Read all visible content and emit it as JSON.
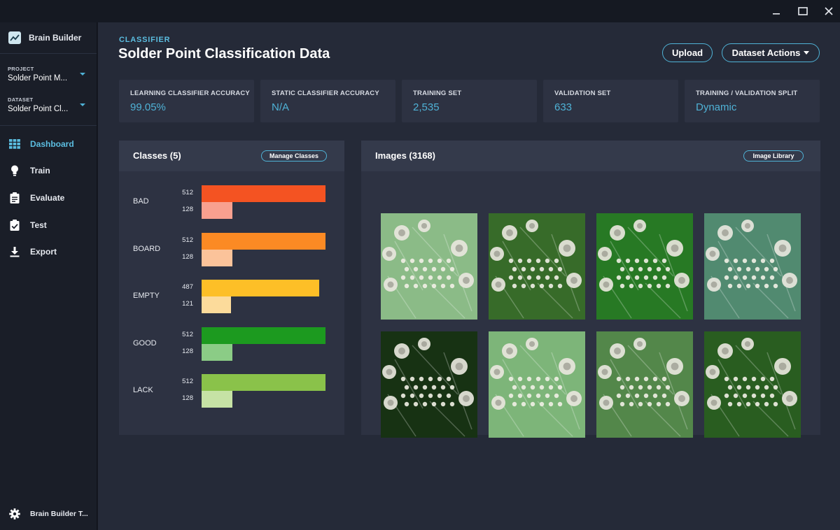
{
  "window": {
    "controls": [
      "minimize-icon",
      "maximize-icon",
      "close-icon"
    ]
  },
  "sidebar": {
    "brand": "Brain Builder",
    "project": {
      "label": "PROJECT",
      "value": "Solder Point M..."
    },
    "dataset": {
      "label": "DATASET",
      "value": "Solder Point Cl..."
    },
    "nav": [
      {
        "label": "Dashboard",
        "icon": "grid-icon",
        "active": true
      },
      {
        "label": "Train",
        "icon": "lightbulb-icon",
        "active": false
      },
      {
        "label": "Evaluate",
        "icon": "clipboard-icon",
        "active": false
      },
      {
        "label": "Test",
        "icon": "clipboard-check-icon",
        "active": false
      },
      {
        "label": "Export",
        "icon": "download-icon",
        "active": false
      }
    ],
    "footer": {
      "label": "Brain Builder T...",
      "icon": "gear-icon"
    }
  },
  "header": {
    "eyebrow": "CLASSIFIER",
    "title": "Solder Point Classification Data",
    "upload_label": "Upload",
    "dataset_actions_label": "Dataset Actions"
  },
  "stats": [
    {
      "label": "LEARNING CLASSIFIER ACCURACY",
      "value": "99.05%"
    },
    {
      "label": "STATIC CLASSIFIER ACCURACY",
      "value": "N/A"
    },
    {
      "label": "TRAINING SET",
      "value": "2,535"
    },
    {
      "label": "VALIDATION SET",
      "value": "633"
    },
    {
      "label": "TRAINING / VALIDATION SPLIT",
      "value": "Dynamic"
    }
  ],
  "classes": {
    "title": "Classes (5)",
    "manage_label": "Manage Classes",
    "max": 512,
    "items": [
      {
        "name": "BAD",
        "train": 512,
        "val": 128,
        "train_color": "#f45322",
        "val_color": "#f8a08f"
      },
      {
        "name": "BOARD",
        "train": 512,
        "val": 128,
        "train_color": "#fb8a24",
        "val_color": "#fbc39a"
      },
      {
        "name": "EMPTY",
        "train": 487,
        "val": 121,
        "train_color": "#fdbf27",
        "val_color": "#fcdb9b"
      },
      {
        "name": "GOOD",
        "train": 512,
        "val": 128,
        "train_color": "#1c9a1f",
        "val_color": "#8bcc86"
      },
      {
        "name": "LACK",
        "train": 512,
        "val": 128,
        "train_color": "#8ac24a",
        "val_color": "#c6e2a5"
      }
    ]
  },
  "images": {
    "title": "Images (3168)",
    "library_label": "Image Library",
    "thumbnails": [
      {
        "tint": "#9fd59a"
      },
      {
        "tint": "#3f7a2f"
      },
      {
        "tint": "#2d8a2a"
      },
      {
        "tint": "#5d9e80"
      },
      {
        "tint": "#1b3a16"
      },
      {
        "tint": "#8fcf8a"
      },
      {
        "tint": "#5f9a55"
      },
      {
        "tint": "#2f6a25"
      }
    ]
  }
}
